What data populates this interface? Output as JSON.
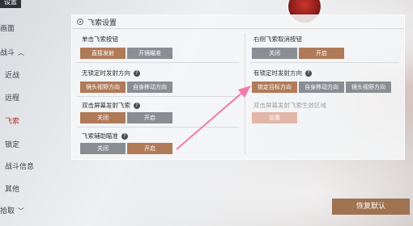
{
  "nav": {
    "top_tab": "设置",
    "items": [
      "画面",
      "战斗",
      "近战",
      "远程",
      "飞索",
      "锁定",
      "战斗信息",
      "其他",
      "拾取"
    ]
  },
  "panel": {
    "title": "飞索设置",
    "single_click": {
      "label": "单击飞索按钮",
      "options": [
        "直接发射",
        "开镜瞄准"
      ]
    },
    "right_cancel": {
      "label": "右侧飞索取消按钮",
      "options": [
        "关闭",
        "开启"
      ]
    },
    "no_lock": {
      "label": "无锁定时发射方向",
      "options": [
        "镜头视野方向",
        "自身移动方向"
      ]
    },
    "has_lock": {
      "label": "有锁定时发射方向",
      "options": [
        "锁定目标方向",
        "自身移动方向",
        "镜头视野方向"
      ]
    },
    "double_click": {
      "label": "双击屏幕发射飞索",
      "options": [
        "关闭",
        "开启"
      ]
    },
    "effective_area": {
      "label": "双击屏幕发射飞索生效区域",
      "button": "设置"
    },
    "assist_aim": {
      "label": "飞索辅助瞄准",
      "options": [
        "关闭",
        "开启"
      ]
    }
  },
  "footer": {
    "restore": "恢复默认"
  },
  "colors": {
    "selected": "#b07a58",
    "unselected": "#8a8e93",
    "accent_arrow": "#f07aa8"
  }
}
